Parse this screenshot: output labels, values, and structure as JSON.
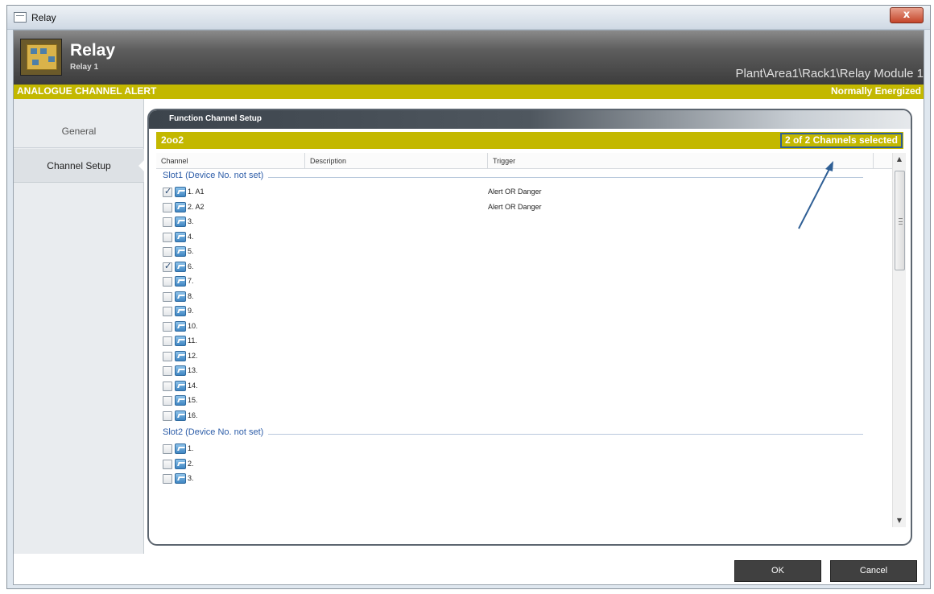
{
  "window": {
    "title": "Relay",
    "close_glyph": "x"
  },
  "header": {
    "title": "Relay",
    "subtitle": "Relay 1",
    "path": "Plant\\Area1\\Rack1\\Relay Module 1",
    "icon": "relay-module-icon"
  },
  "alert_bar": {
    "left": "ANALOGUE CHANNEL ALERT",
    "right": "Normally Energized"
  },
  "sidebar": {
    "items": [
      {
        "label": "General"
      },
      {
        "label": "Channel Setup"
      }
    ]
  },
  "panel": {
    "title": "Function Channel Setup",
    "vote": "2oo2",
    "selection_count": "2 of 2 Channels selected"
  },
  "columns": {
    "channel": "Channel",
    "description": "Description",
    "trigger": "Trigger"
  },
  "slots": [
    {
      "title": "Slot1 (Device No. not set)",
      "channels": [
        {
          "label": "1. A1",
          "checked": true,
          "trigger": "Alert OR Danger"
        },
        {
          "label": "2. A2",
          "checked": false,
          "trigger": "Alert OR Danger"
        },
        {
          "label": "3.",
          "checked": false,
          "trigger": ""
        },
        {
          "label": "4.",
          "checked": false,
          "trigger": ""
        },
        {
          "label": "5.",
          "checked": false,
          "trigger": ""
        },
        {
          "label": "6.",
          "checked": true,
          "trigger": ""
        },
        {
          "label": "7.",
          "checked": false,
          "trigger": ""
        },
        {
          "label": "8.",
          "checked": false,
          "trigger": ""
        },
        {
          "label": "9.",
          "checked": false,
          "trigger": ""
        },
        {
          "label": "10.",
          "checked": false,
          "trigger": ""
        },
        {
          "label": "11.",
          "checked": false,
          "trigger": ""
        },
        {
          "label": "12.",
          "checked": false,
          "trigger": ""
        },
        {
          "label": "13.",
          "checked": false,
          "trigger": ""
        },
        {
          "label": "14.",
          "checked": false,
          "trigger": ""
        },
        {
          "label": "15.",
          "checked": false,
          "trigger": ""
        },
        {
          "label": "16.",
          "checked": false,
          "trigger": ""
        }
      ]
    },
    {
      "title": "Slot2 (Device No. not set)",
      "channels": [
        {
          "label": "1.",
          "checked": false,
          "trigger": ""
        },
        {
          "label": "2.",
          "checked": false,
          "trigger": ""
        },
        {
          "label": "3.",
          "checked": false,
          "trigger": ""
        }
      ]
    }
  ],
  "scrollbar": {
    "up_glyph": "▲",
    "down_glyph": "▼"
  },
  "footer": {
    "ok_label": "OK",
    "cancel_label": "Cancel"
  },
  "colors": {
    "accent_yellow": "#c3b800",
    "header_dark": "#3c3c3c",
    "link_blue": "#2d5da8",
    "annotation_blue": "#2f5f95"
  }
}
